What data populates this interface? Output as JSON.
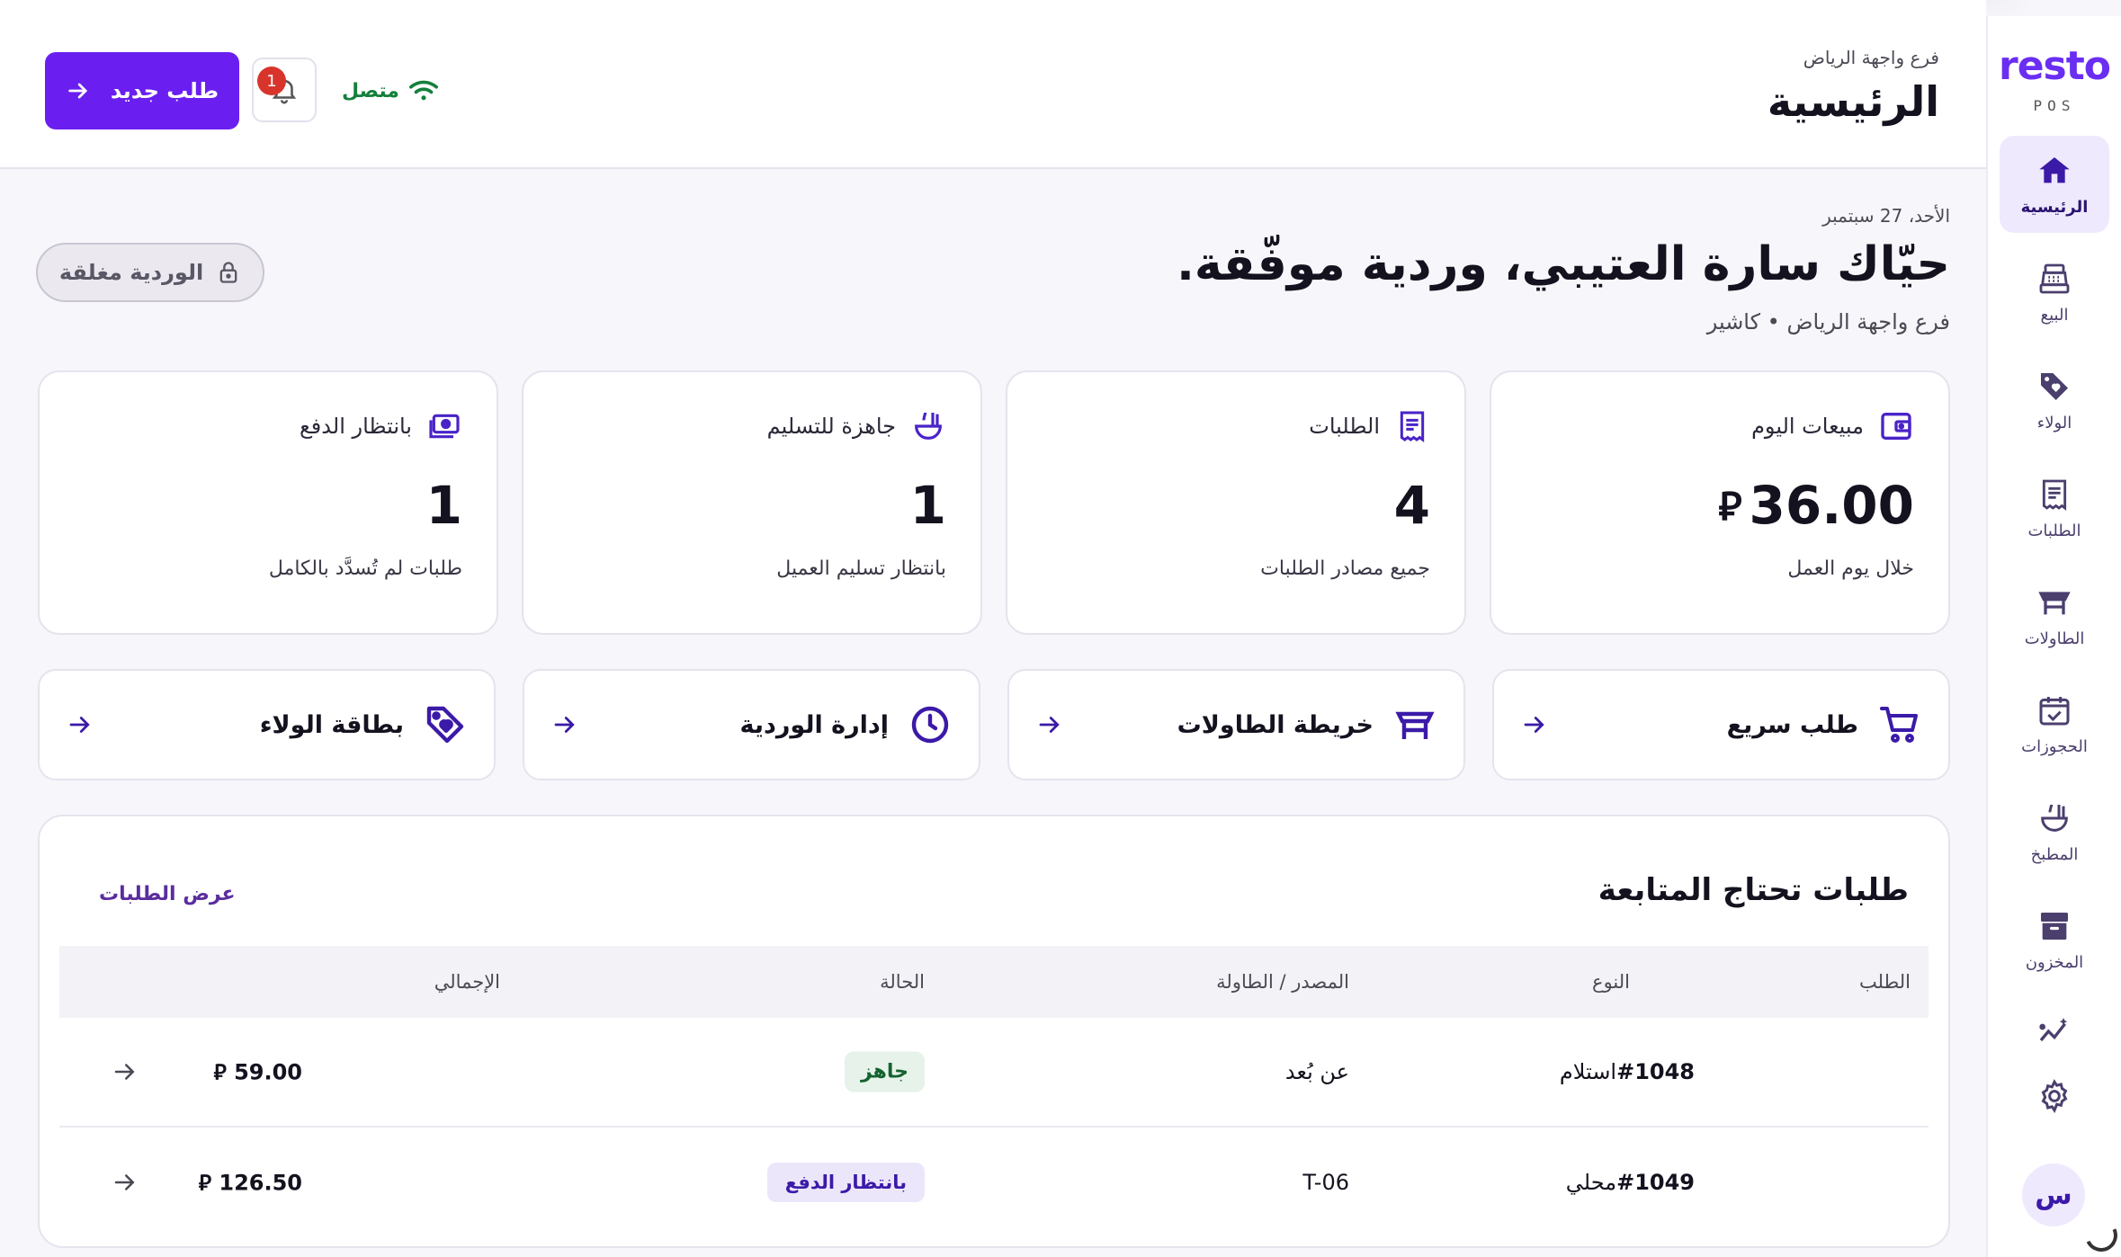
{
  "brand": {
    "logo": "resto",
    "sub": "POS"
  },
  "sidebar": {
    "items": [
      {
        "label": "الرئيسية",
        "icon": "home-icon",
        "active": true
      },
      {
        "label": "البيع",
        "icon": "cash-register-icon"
      },
      {
        "label": "الولاء",
        "icon": "loyalty-tag-icon"
      },
      {
        "label": "الطلبات",
        "icon": "receipt-icon"
      },
      {
        "label": "الطاولات",
        "icon": "table-icon"
      },
      {
        "label": "الحجوزات",
        "icon": "calendar-check-icon"
      },
      {
        "label": "المطبخ",
        "icon": "kitchen-ladle-icon"
      },
      {
        "label": "المخزون",
        "icon": "archive-box-icon"
      }
    ],
    "extra_icons": [
      "analytics-sparkle-icon",
      "gear-icon"
    ],
    "avatar": "س"
  },
  "header": {
    "branch": "فرع واجهة الرياض",
    "title": "الرئيسية",
    "new_order_label": "طلب جديد",
    "notifications_count": "1",
    "connection_label": "متصل"
  },
  "main": {
    "date": "الأحد، 27 سبتمبر",
    "greeting": "حيّاك سارة العتيبي، وردية موفّقة.",
    "subline": "فرع واجهة الرياض • كاشير",
    "shift_status": "الوردية مغلقة"
  },
  "stats": [
    {
      "title": "مبيعات اليوم",
      "value": "36.00",
      "currency": "⃁",
      "sub": "خلال يوم العمل",
      "icon": "wallet-icon"
    },
    {
      "title": "الطلبات",
      "value": "4",
      "sub": "جميع مصادر الطلبات",
      "icon": "receipt-icon"
    },
    {
      "title": "جاهزة للتسليم",
      "value": "1",
      "sub": "بانتظار تسليم العميل",
      "icon": "ladle-icon"
    },
    {
      "title": "بانتظار الدفع",
      "value": "1",
      "sub": "طلبات لم تُسدَّد بالكامل",
      "icon": "cash-note-icon"
    }
  ],
  "quick_actions": [
    {
      "label": "طلب سريع",
      "icon": "cart-icon"
    },
    {
      "label": "خريطة الطاولات",
      "icon": "table-icon"
    },
    {
      "label": "إدارة الوردية",
      "icon": "clock-icon"
    },
    {
      "label": "بطاقة الولاء",
      "icon": "loyalty-tag-icon"
    }
  ],
  "orders": {
    "title": "طلبات تحتاج المتابعة",
    "view_all": "عرض الطلبات",
    "columns": {
      "order": "الطلب",
      "type": "النوع",
      "source": "المصدر / الطاولة",
      "status": "الحالة",
      "total": "الإجمالي"
    },
    "rows": [
      {
        "id": "#1048",
        "type": "استلام",
        "source": "عن بُعد",
        "status": "جاهز",
        "status_kind": "ready",
        "total": "59.00"
      },
      {
        "id": "#1049",
        "type": "محلي",
        "source": "T-06",
        "status": "بانتظار الدفع",
        "status_kind": "pay",
        "total": "126.50"
      }
    ],
    "currency": "⃁"
  },
  "colors": {
    "accent": "#6a1ff0",
    "success": "#15803d",
    "danger": "#d9342b",
    "bg": "#f7f6fa"
  }
}
